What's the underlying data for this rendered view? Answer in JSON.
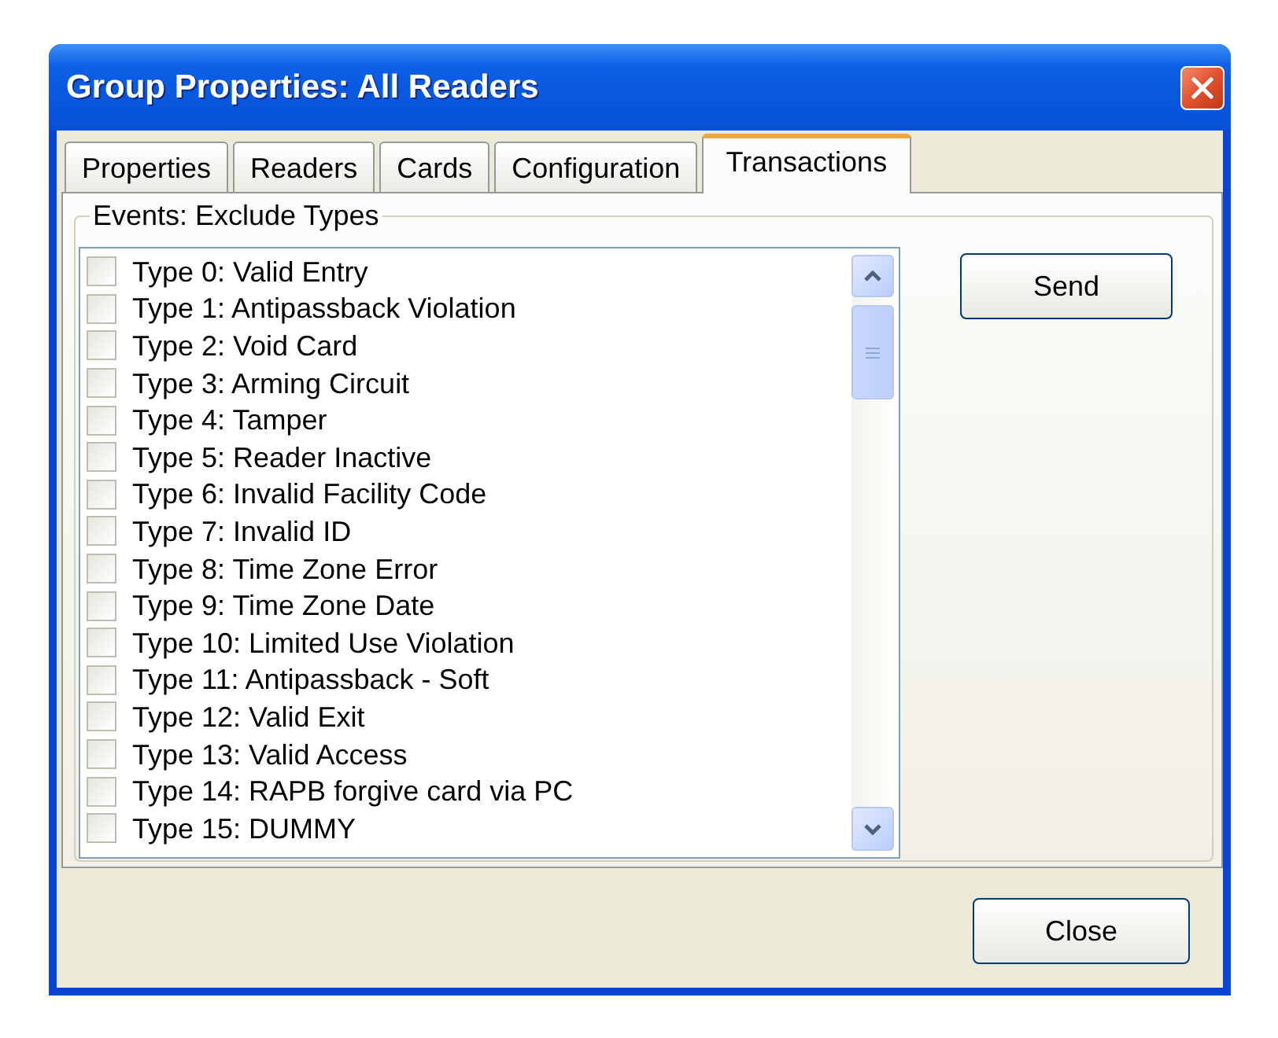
{
  "window": {
    "title": "Group Properties: All Readers"
  },
  "tabs": [
    {
      "label": "Properties",
      "selected": false
    },
    {
      "label": "Readers",
      "selected": false
    },
    {
      "label": "Cards",
      "selected": false
    },
    {
      "label": "Configuration",
      "selected": false
    },
    {
      "label": "Transactions",
      "selected": true
    }
  ],
  "event_types": {
    "title": "Events: Exclude Types",
    "items": [
      {
        "label": "Type 0: Valid Entry",
        "checked": false
      },
      {
        "label": "Type 1: Antipassback Violation",
        "checked": false
      },
      {
        "label": "Type 2: Void Card",
        "checked": false
      },
      {
        "label": "Type 3: Arming Circuit",
        "checked": false
      },
      {
        "label": "Type 4: Tamper",
        "checked": false
      },
      {
        "label": "Type 5: Reader Inactive",
        "checked": false
      },
      {
        "label": "Type 6: Invalid Facility Code",
        "checked": false
      },
      {
        "label": "Type 7: Invalid ID",
        "checked": false
      },
      {
        "label": "Type 8: Time Zone Error",
        "checked": false
      },
      {
        "label": "Type 9: Time Zone Date",
        "checked": false
      },
      {
        "label": "Type 10: Limited Use Violation",
        "checked": false
      },
      {
        "label": "Type 11: Antipassback - Soft",
        "checked": false
      },
      {
        "label": "Type 12: Valid Exit",
        "checked": false
      },
      {
        "label": "Type 13: Valid Access",
        "checked": false
      },
      {
        "label": "Type 14: RAPB forgive card via PC",
        "checked": false
      },
      {
        "label": "Type 15: DUMMY",
        "checked": false
      }
    ]
  },
  "send_button": {
    "label": "Send"
  },
  "close_button": {
    "label": "Close"
  }
}
